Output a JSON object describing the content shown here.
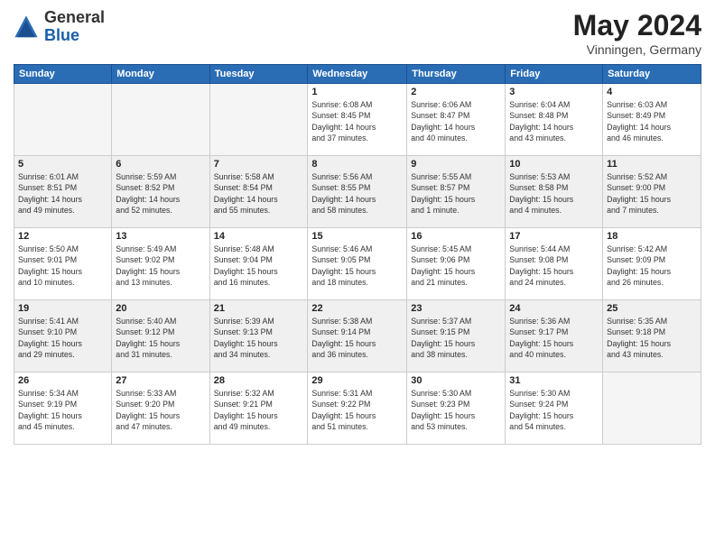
{
  "header": {
    "logo": {
      "general": "General",
      "blue": "Blue"
    },
    "title": "May 2024",
    "location": "Vinningen, Germany"
  },
  "weekdays": [
    "Sunday",
    "Monday",
    "Tuesday",
    "Wednesday",
    "Thursday",
    "Friday",
    "Saturday"
  ],
  "weeks": [
    [
      {
        "day": "",
        "info": "",
        "empty": true
      },
      {
        "day": "",
        "info": "",
        "empty": true
      },
      {
        "day": "",
        "info": "",
        "empty": true
      },
      {
        "day": "1",
        "info": "Sunrise: 6:08 AM\nSunset: 8:45 PM\nDaylight: 14 hours\nand 37 minutes."
      },
      {
        "day": "2",
        "info": "Sunrise: 6:06 AM\nSunset: 8:47 PM\nDaylight: 14 hours\nand 40 minutes."
      },
      {
        "day": "3",
        "info": "Sunrise: 6:04 AM\nSunset: 8:48 PM\nDaylight: 14 hours\nand 43 minutes."
      },
      {
        "day": "4",
        "info": "Sunrise: 6:03 AM\nSunset: 8:49 PM\nDaylight: 14 hours\nand 46 minutes."
      }
    ],
    [
      {
        "day": "5",
        "info": "Sunrise: 6:01 AM\nSunset: 8:51 PM\nDaylight: 14 hours\nand 49 minutes.",
        "shaded": true
      },
      {
        "day": "6",
        "info": "Sunrise: 5:59 AM\nSunset: 8:52 PM\nDaylight: 14 hours\nand 52 minutes.",
        "shaded": true
      },
      {
        "day": "7",
        "info": "Sunrise: 5:58 AM\nSunset: 8:54 PM\nDaylight: 14 hours\nand 55 minutes.",
        "shaded": true
      },
      {
        "day": "8",
        "info": "Sunrise: 5:56 AM\nSunset: 8:55 PM\nDaylight: 14 hours\nand 58 minutes.",
        "shaded": true
      },
      {
        "day": "9",
        "info": "Sunrise: 5:55 AM\nSunset: 8:57 PM\nDaylight: 15 hours\nand 1 minute.",
        "shaded": true
      },
      {
        "day": "10",
        "info": "Sunrise: 5:53 AM\nSunset: 8:58 PM\nDaylight: 15 hours\nand 4 minutes.",
        "shaded": true
      },
      {
        "day": "11",
        "info": "Sunrise: 5:52 AM\nSunset: 9:00 PM\nDaylight: 15 hours\nand 7 minutes.",
        "shaded": true
      }
    ],
    [
      {
        "day": "12",
        "info": "Sunrise: 5:50 AM\nSunset: 9:01 PM\nDaylight: 15 hours\nand 10 minutes."
      },
      {
        "day": "13",
        "info": "Sunrise: 5:49 AM\nSunset: 9:02 PM\nDaylight: 15 hours\nand 13 minutes."
      },
      {
        "day": "14",
        "info": "Sunrise: 5:48 AM\nSunset: 9:04 PM\nDaylight: 15 hours\nand 16 minutes."
      },
      {
        "day": "15",
        "info": "Sunrise: 5:46 AM\nSunset: 9:05 PM\nDaylight: 15 hours\nand 18 minutes."
      },
      {
        "day": "16",
        "info": "Sunrise: 5:45 AM\nSunset: 9:06 PM\nDaylight: 15 hours\nand 21 minutes."
      },
      {
        "day": "17",
        "info": "Sunrise: 5:44 AM\nSunset: 9:08 PM\nDaylight: 15 hours\nand 24 minutes."
      },
      {
        "day": "18",
        "info": "Sunrise: 5:42 AM\nSunset: 9:09 PM\nDaylight: 15 hours\nand 26 minutes."
      }
    ],
    [
      {
        "day": "19",
        "info": "Sunrise: 5:41 AM\nSunset: 9:10 PM\nDaylight: 15 hours\nand 29 minutes.",
        "shaded": true
      },
      {
        "day": "20",
        "info": "Sunrise: 5:40 AM\nSunset: 9:12 PM\nDaylight: 15 hours\nand 31 minutes.",
        "shaded": true
      },
      {
        "day": "21",
        "info": "Sunrise: 5:39 AM\nSunset: 9:13 PM\nDaylight: 15 hours\nand 34 minutes.",
        "shaded": true
      },
      {
        "day": "22",
        "info": "Sunrise: 5:38 AM\nSunset: 9:14 PM\nDaylight: 15 hours\nand 36 minutes.",
        "shaded": true
      },
      {
        "day": "23",
        "info": "Sunrise: 5:37 AM\nSunset: 9:15 PM\nDaylight: 15 hours\nand 38 minutes.",
        "shaded": true
      },
      {
        "day": "24",
        "info": "Sunrise: 5:36 AM\nSunset: 9:17 PM\nDaylight: 15 hours\nand 40 minutes.",
        "shaded": true
      },
      {
        "day": "25",
        "info": "Sunrise: 5:35 AM\nSunset: 9:18 PM\nDaylight: 15 hours\nand 43 minutes.",
        "shaded": true
      }
    ],
    [
      {
        "day": "26",
        "info": "Sunrise: 5:34 AM\nSunset: 9:19 PM\nDaylight: 15 hours\nand 45 minutes."
      },
      {
        "day": "27",
        "info": "Sunrise: 5:33 AM\nSunset: 9:20 PM\nDaylight: 15 hours\nand 47 minutes."
      },
      {
        "day": "28",
        "info": "Sunrise: 5:32 AM\nSunset: 9:21 PM\nDaylight: 15 hours\nand 49 minutes."
      },
      {
        "day": "29",
        "info": "Sunrise: 5:31 AM\nSunset: 9:22 PM\nDaylight: 15 hours\nand 51 minutes."
      },
      {
        "day": "30",
        "info": "Sunrise: 5:30 AM\nSunset: 9:23 PM\nDaylight: 15 hours\nand 53 minutes."
      },
      {
        "day": "31",
        "info": "Sunrise: 5:30 AM\nSunset: 9:24 PM\nDaylight: 15 hours\nand 54 minutes."
      },
      {
        "day": "",
        "info": "",
        "empty": true
      }
    ]
  ]
}
